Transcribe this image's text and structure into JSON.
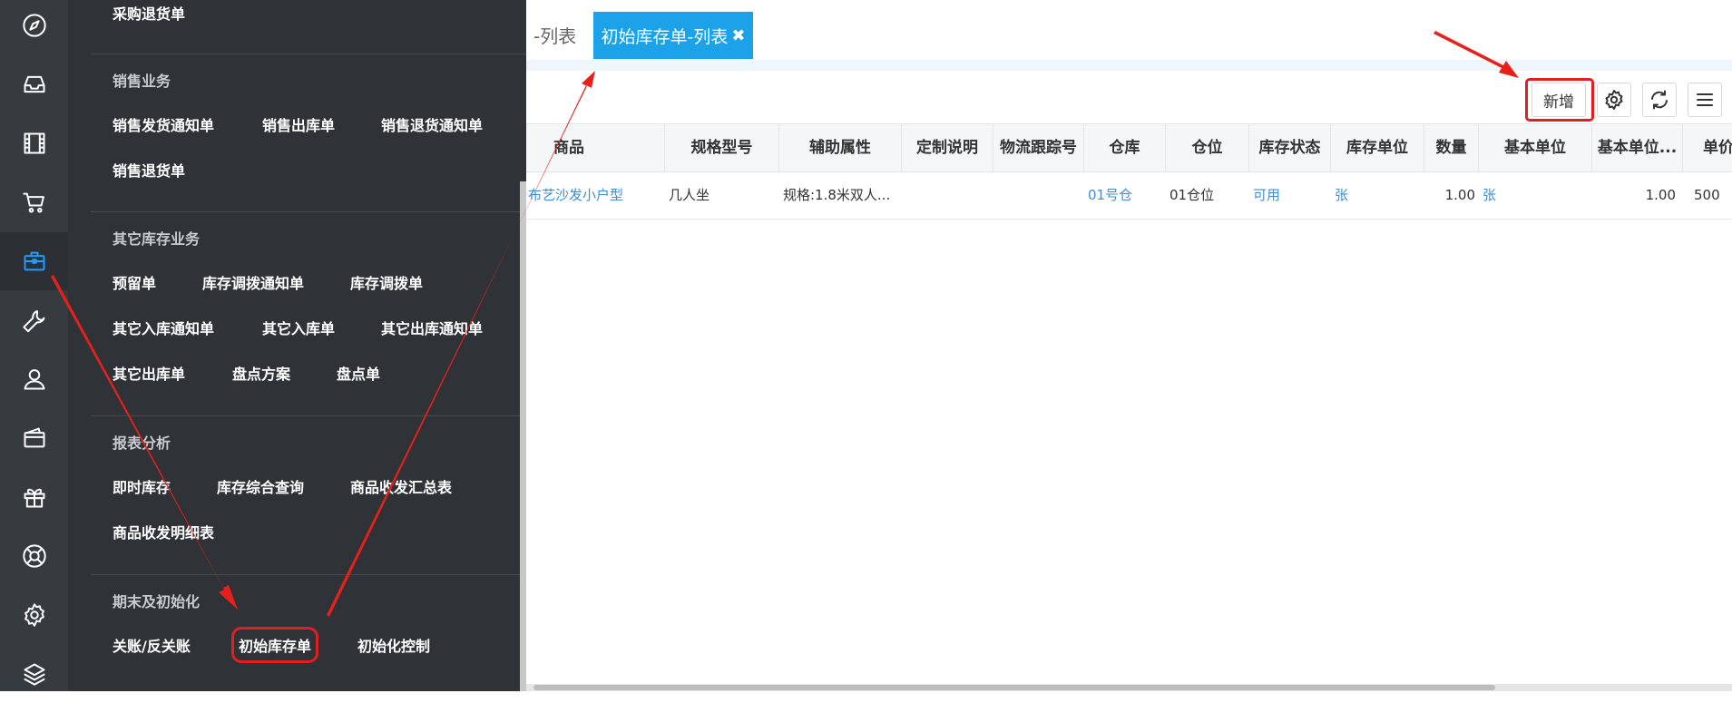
{
  "rail": {
    "icons": [
      "compass-icon",
      "inbox-icon",
      "film-icon",
      "cart-icon",
      "briefcase-icon",
      "wrench-icon",
      "user-icon",
      "wallet-icon",
      "gift-icon",
      "lifebuoy-icon",
      "gear-icon",
      "layers-icon"
    ],
    "active_icon": "briefcase-icon"
  },
  "menu": {
    "top_item": "采购退货单",
    "sections": [
      {
        "title": "销售业务",
        "items": [
          "销售发货通知单",
          "销售出库单",
          "销售退货通知单",
          "销售退货单"
        ]
      },
      {
        "title": "其它库存业务",
        "items": [
          "预留单",
          "库存调拨通知单",
          "库存调拨单",
          "其它入库通知单",
          "其它入库单",
          "其它出库通知单",
          "其它出库单",
          "盘点方案",
          "盘点单"
        ]
      },
      {
        "title": "报表分析",
        "items": [
          "即时库存",
          "库存综合查询",
          "商品收发汇总表",
          "商品收发明细表"
        ]
      },
      {
        "title": "期末及初始化",
        "items": [
          "关账/反关账",
          "初始库存单",
          "初始化控制"
        ]
      }
    ],
    "highlighted_item": "初始库存单"
  },
  "tabs": {
    "prev_label": "-列表",
    "active_label": "初始库存单-列表",
    "close_glyph": "✖"
  },
  "toolbar": {
    "add_label": "新增",
    "settings_icon": "gear-icon",
    "refresh_icon": "refresh-icon",
    "menu_icon": "hamburger-icon"
  },
  "table": {
    "columns": [
      "商品",
      "规格型号",
      "辅助属性",
      "定制说明",
      "物流跟踪号",
      "仓库",
      "仓位",
      "库存状态",
      "库存单位",
      "数量",
      "基本单位",
      "基本单位...",
      "单价"
    ],
    "rows": [
      [
        "布艺沙发小户型",
        "几人坐",
        "规格:1.8米双人...",
        "",
        "",
        "01号仓",
        "01仓位",
        "可用",
        "张",
        "1.00",
        "张",
        "1.00",
        "500"
      ]
    ]
  },
  "colors": {
    "accent": "#1ba2e8",
    "highlight_red": "#e02020",
    "link": "#3c8fd6",
    "menu_bg": "#2f3337",
    "rail_bg": "#363b40"
  }
}
